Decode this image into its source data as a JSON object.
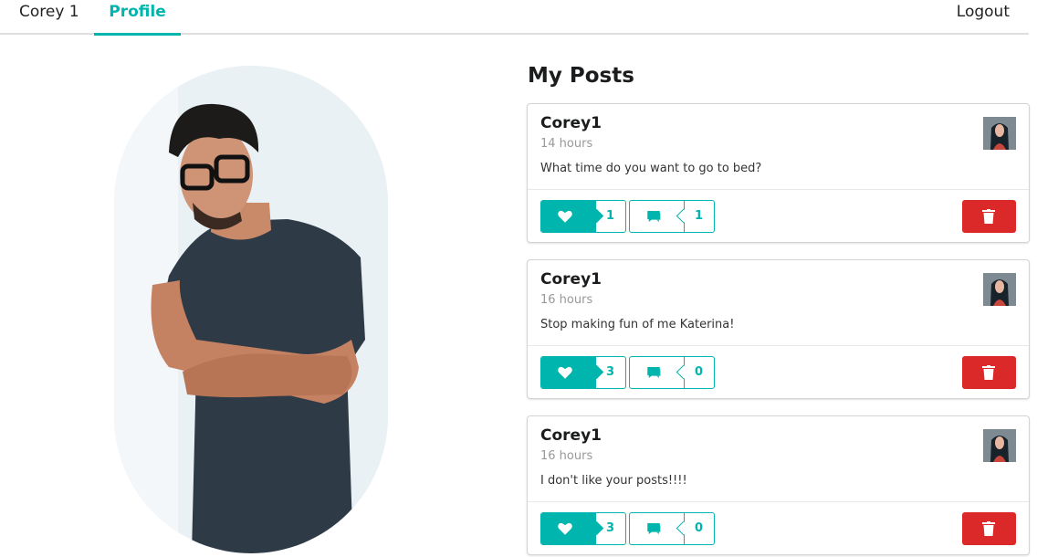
{
  "nav": {
    "user_label": "Corey 1",
    "profile_label": "Profile",
    "logout_label": "Logout"
  },
  "posts_section": {
    "title": "My Posts"
  },
  "posts": [
    {
      "author": "Corey1",
      "time": "14 hours",
      "text": "What time do you want to go to bed?",
      "likes": "1",
      "comments": "1"
    },
    {
      "author": "Corey1",
      "time": "16 hours",
      "text": "Stop making fun of me Katerina!",
      "likes": "3",
      "comments": "0"
    },
    {
      "author": "Corey1",
      "time": "16 hours",
      "text": "I don't like your posts!!!!",
      "likes": "3",
      "comments": "0"
    }
  ],
  "icons": {
    "like": "heart-icon",
    "comment": "comment-icon",
    "delete": "trash-icon"
  },
  "colors": {
    "accent": "#00b5ad",
    "danger": "#db2828",
    "divider": "#dedede"
  }
}
